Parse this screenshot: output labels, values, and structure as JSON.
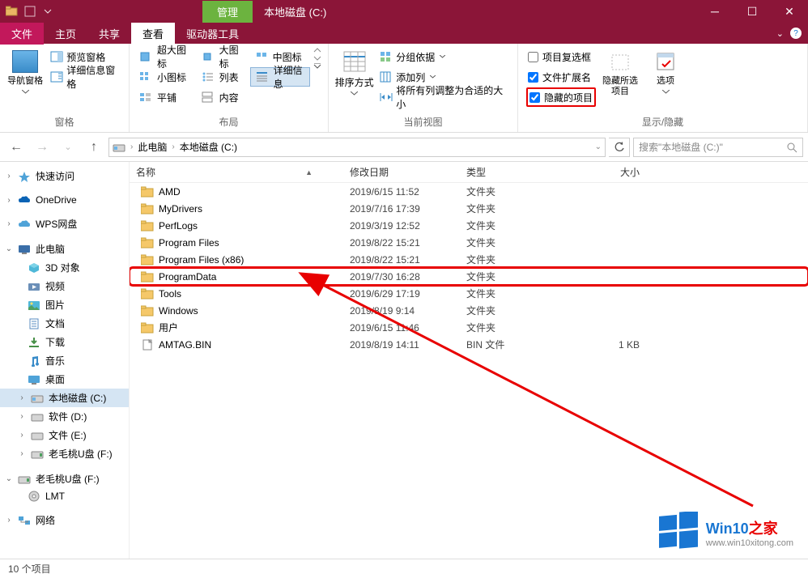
{
  "titlebar": {
    "manage_label": "管理",
    "title": "本地磁盘 (C:)"
  },
  "ribbon_tabs": {
    "file": "文件",
    "home": "主页",
    "share": "共享",
    "view": "查看",
    "drive_tools": "驱动器工具"
  },
  "ribbon": {
    "panes": {
      "nav_pane": "导航窗格",
      "preview_pane": "预览窗格",
      "detail_pane": "详细信息窗格",
      "group_label": "窗格"
    },
    "layout": {
      "extra_large": "超大图标",
      "large": "大图标",
      "medium": "中图标",
      "small": "小图标",
      "list": "列表",
      "details": "详细信息",
      "tiles": "平铺",
      "content": "内容",
      "group_label": "布局"
    },
    "current_view": {
      "sort_by": "排序方式",
      "group_by": "分组依据",
      "add_column": "添加列",
      "size_all": "将所有列调整为合适的大小",
      "group_label": "当前视图"
    },
    "show_hide": {
      "item_checkboxes": "项目复选框",
      "file_ext": "文件扩展名",
      "hidden_items": "隐藏的项目",
      "hide_selected": "隐藏所选项目",
      "options": "选项",
      "group_label": "显示/隐藏"
    }
  },
  "address": {
    "this_pc": "此电脑",
    "drive": "本地磁盘 (C:)"
  },
  "search": {
    "placeholder": "搜索\"本地磁盘 (C:)\""
  },
  "columns": {
    "name": "名称",
    "date": "修改日期",
    "type": "类型",
    "size": "大小"
  },
  "sidebar": {
    "quick_access": "快速访问",
    "onedrive": "OneDrive",
    "wps": "WPS网盘",
    "this_pc": "此电脑",
    "objects3d": "3D 对象",
    "videos": "视频",
    "pictures": "图片",
    "documents": "文档",
    "downloads": "下载",
    "music": "音乐",
    "desktop": "桌面",
    "drive_c": "本地磁盘 (C:)",
    "drive_d": "软件 (D:)",
    "drive_e": "文件 (E:)",
    "drive_f1": "老毛桃U盘 (F:)",
    "drive_f2": "老毛桃U盘 (F:)",
    "lmt": "LMT",
    "network": "网络"
  },
  "files": [
    {
      "name": "AMD",
      "date": "2019/6/15 11:52",
      "type": "文件夹",
      "size": ""
    },
    {
      "name": "MyDrivers",
      "date": "2019/7/16 17:39",
      "type": "文件夹",
      "size": ""
    },
    {
      "name": "PerfLogs",
      "date": "2019/3/19 12:52",
      "type": "文件夹",
      "size": ""
    },
    {
      "name": "Program Files",
      "date": "2019/8/22 15:21",
      "type": "文件夹",
      "size": ""
    },
    {
      "name": "Program Files (x86)",
      "date": "2019/8/22 15:21",
      "type": "文件夹",
      "size": ""
    },
    {
      "name": "ProgramData",
      "date": "2019/7/30 16:28",
      "type": "文件夹",
      "size": "",
      "highlighted": true
    },
    {
      "name": "Tools",
      "date": "2019/6/29 17:19",
      "type": "文件夹",
      "size": ""
    },
    {
      "name": "Windows",
      "date": "2019/8/19 9:14",
      "type": "文件夹",
      "size": ""
    },
    {
      "name": "用户",
      "date": "2019/6/15 11:46",
      "type": "文件夹",
      "size": ""
    },
    {
      "name": "AMTAG.BIN",
      "date": "2019/8/19 14:11",
      "type": "BIN 文件",
      "size": "1 KB",
      "is_file": true
    }
  ],
  "status": {
    "item_count": "10 个项目"
  },
  "watermark": {
    "brand1": "Win10",
    "brand2": "之家",
    "url": "www.win10xitong.com"
  }
}
